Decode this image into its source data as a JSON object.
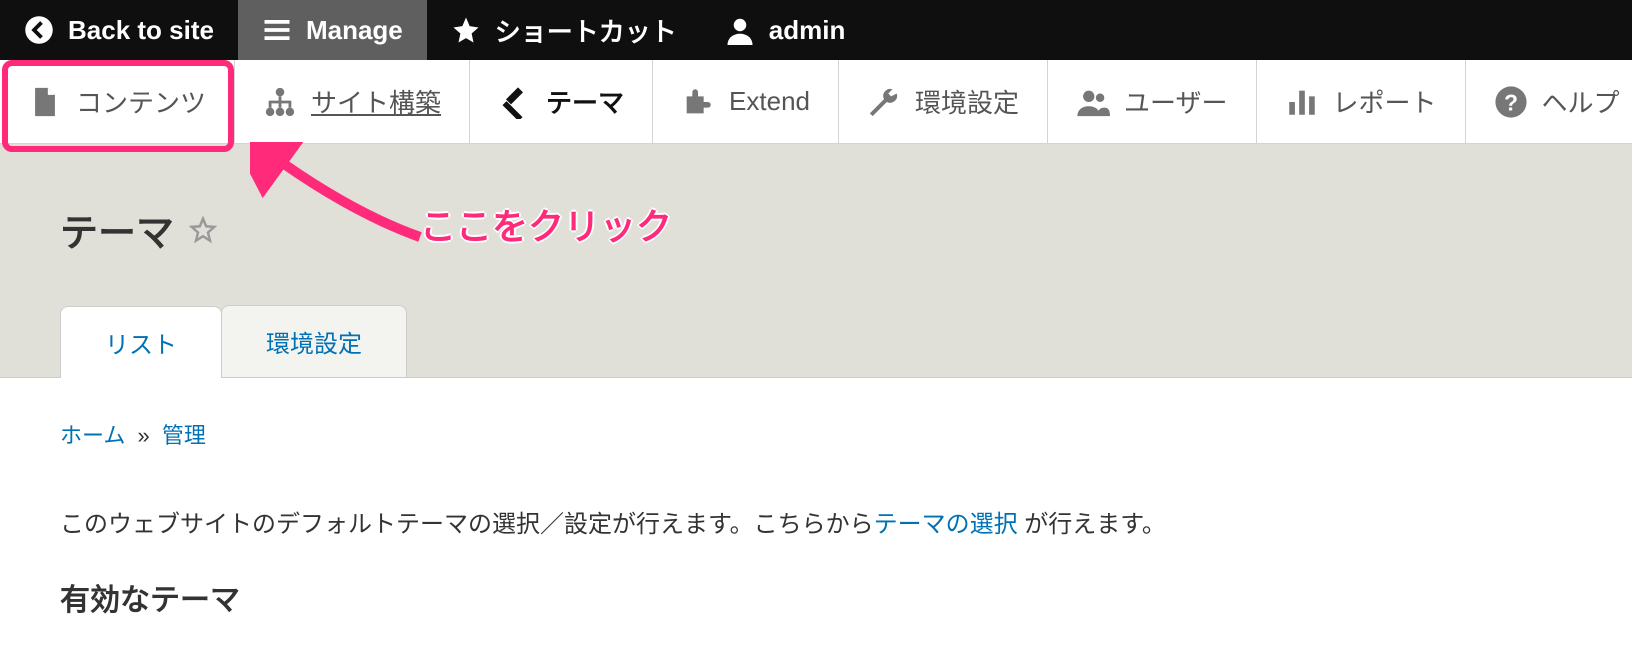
{
  "toolbar": {
    "back": "Back to site",
    "manage": "Manage",
    "shortcuts": "ショートカット",
    "user": "admin"
  },
  "adminMenu": {
    "content": "コンテンツ",
    "structure": "サイト構築",
    "appearance": "テーマ",
    "extend": "Extend",
    "config": "環境設定",
    "people": "ユーザー",
    "reports": "レポート",
    "help": "ヘルプ"
  },
  "annotation": "ここをクリック",
  "page": {
    "title": "テーマ",
    "tabs": {
      "list": "リスト",
      "settings": "環境設定"
    },
    "breadcrumb": {
      "home": "ホーム",
      "sep": "»",
      "admin": "管理"
    },
    "descPre": "このウェブサイトのデフォルトテーマの選択／設定が行えます。こちらから",
    "descLink": "テーマの選択",
    "descPost": " が行えます。",
    "sectionHeading": "有効なテーマ"
  }
}
